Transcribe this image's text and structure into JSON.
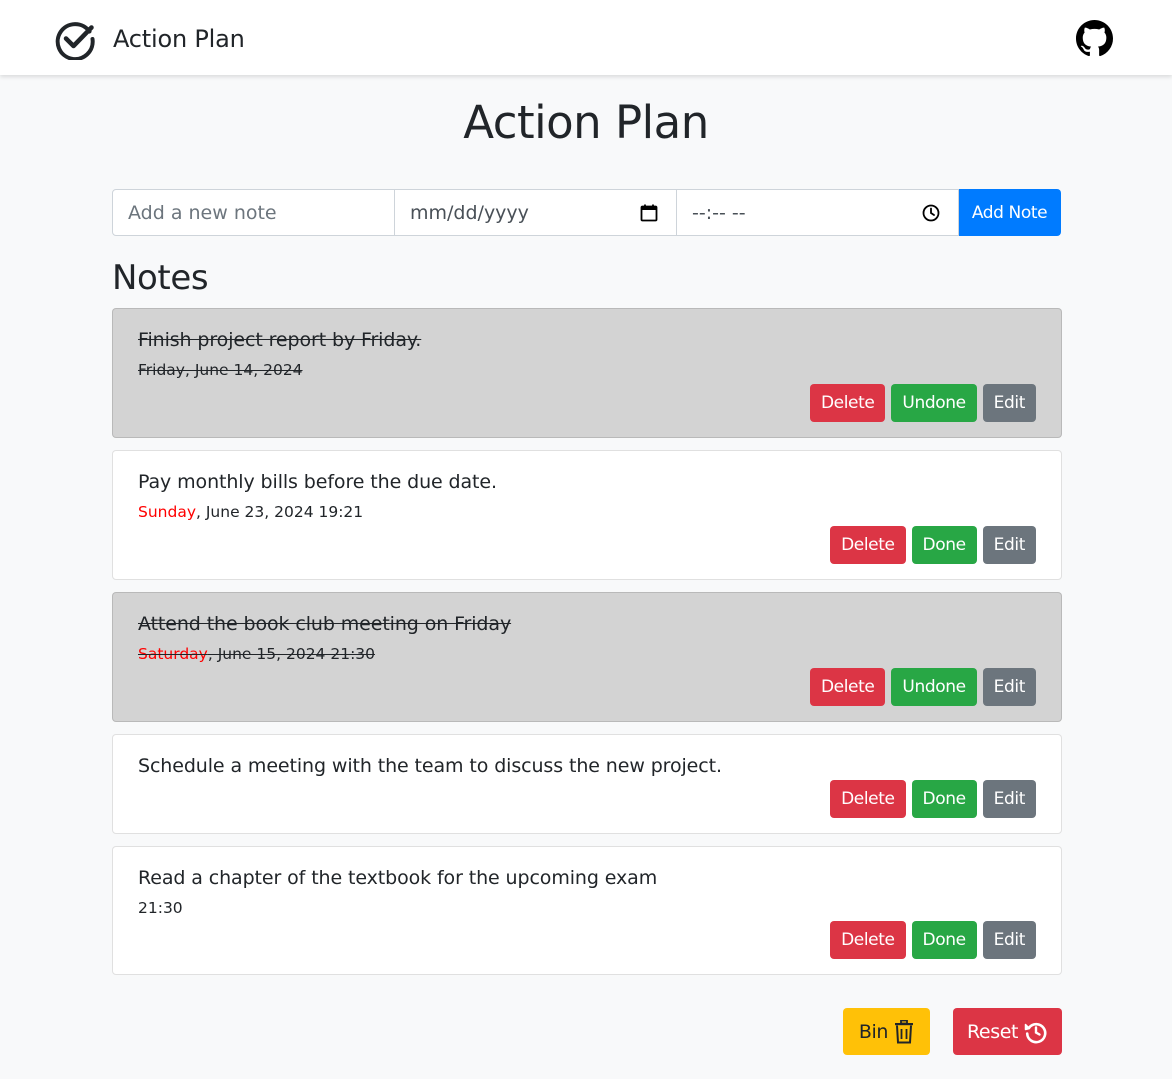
{
  "navbar": {
    "brand": "Action Plan",
    "brand_icon": "check-circle-icon",
    "github_icon": "github-icon"
  },
  "page_title": "Action Plan",
  "form": {
    "note_placeholder": "Add a new note",
    "date_placeholder": "mm/dd/yyyy",
    "time_placeholder": "--:-- --",
    "add_label": "Add Note",
    "calendar_icon": "calendar-icon",
    "clock_icon": "clock-icon"
  },
  "notes_heading": "Notes",
  "notes": [
    {
      "text": "Finish project report by Friday.",
      "date_day": "",
      "date_rest": "Friday, June 14, 2024",
      "completed": true,
      "toggle_label": "Undone"
    },
    {
      "text": "Pay monthly bills before the due date.",
      "date_day": "Sunday",
      "date_rest": ", June 23, 2024 19:21",
      "completed": false,
      "toggle_label": "Done"
    },
    {
      "text": "Attend the book club meeting on Friday",
      "date_day": "Saturday",
      "date_rest": ", June 15, 2024 21:30",
      "completed": true,
      "toggle_label": "Undone"
    },
    {
      "text": "Schedule a meeting with the team to discuss the new project.",
      "date_day": "",
      "date_rest": "",
      "completed": false,
      "toggle_label": "Done"
    },
    {
      "text": "Read a chapter of the textbook for the upcoming exam",
      "date_day": "",
      "date_rest": "21:30",
      "completed": false,
      "toggle_label": "Done"
    }
  ],
  "buttons": {
    "delete": "Delete",
    "edit": "Edit"
  },
  "footer": {
    "bin_label": "Bin",
    "bin_icon": "trash-icon",
    "reset_label": "Reset",
    "reset_icon": "history-icon"
  },
  "colors": {
    "primary": "#007bff",
    "danger": "#dc3545",
    "success": "#28a745",
    "secondary": "#6c757d",
    "warning": "#ffc107",
    "completed_bg": "#d3d3d3",
    "weekend_day": "#ff0000"
  }
}
